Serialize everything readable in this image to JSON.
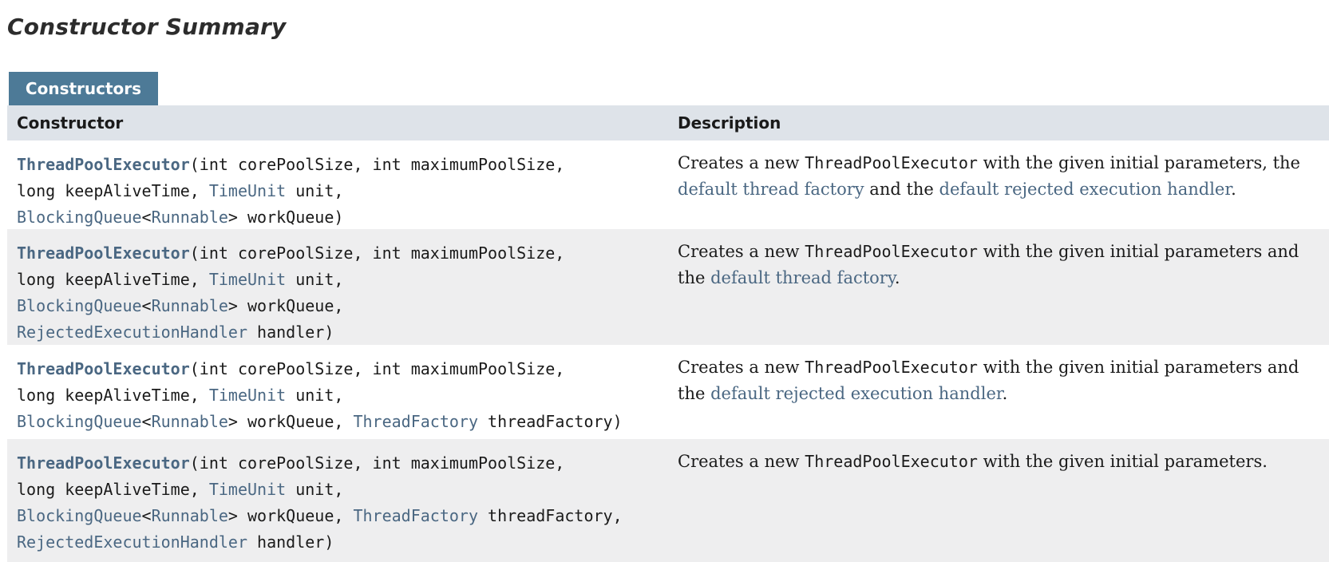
{
  "section_title": "Constructor Summary",
  "caption": "Constructors",
  "table": {
    "headers": {
      "constructor": "Constructor",
      "description": "Description"
    },
    "rows": [
      {
        "name": "ThreadPoolExecutor",
        "sig": {
          "p1": "(int corePoolSize, int maximumPoolSize,",
          "p2": "long keepAliveTime, ",
          "t_timeunit": "TimeUnit",
          "p3": " unit,",
          "t_bq": "BlockingQueue",
          "lt": "<",
          "t_runnable": "Runnable",
          "p4": "> workQueue)"
        },
        "desc": {
          "d1": "Creates a new ",
          "code": "ThreadPoolExecutor",
          "d2": " with the given initial parameters, the ",
          "link1": "default thread factory",
          "d3": " and the ",
          "link2": "default rejected execution handler",
          "d4": "."
        }
      },
      {
        "name": "ThreadPoolExecutor",
        "sig": {
          "p1": "(int corePoolSize, int maximumPoolSize,",
          "p2": "long keepAliveTime, ",
          "t_timeunit": "TimeUnit",
          "p3": " unit,",
          "t_bq": "BlockingQueue",
          "lt": "<",
          "t_runnable": "Runnable",
          "p4": "> workQueue,",
          "t_reh": "RejectedExecutionHandler",
          "p5": " handler)"
        },
        "desc": {
          "d1": "Creates a new ",
          "code": "ThreadPoolExecutor",
          "d2": " with the given initial parameters and the ",
          "link1": "default thread factory",
          "d3": "."
        }
      },
      {
        "name": "ThreadPoolExecutor",
        "sig": {
          "p1": "(int corePoolSize, int maximumPoolSize,",
          "p2": "long keepAliveTime, ",
          "t_timeunit": "TimeUnit",
          "p3": " unit,",
          "t_bq": "BlockingQueue",
          "lt": "<",
          "t_runnable": "Runnable",
          "p4": "> workQueue, ",
          "t_tf": "ThreadFactory",
          "p5": " threadFactory)"
        },
        "desc": {
          "d1": "Creates a new ",
          "code": "ThreadPoolExecutor",
          "d2": " with the given initial parameters and the ",
          "link1": "default rejected execution handler",
          "d3": "."
        }
      },
      {
        "name": "ThreadPoolExecutor",
        "sig": {
          "p1": "(int corePoolSize, int maximumPoolSize,",
          "p2": "long keepAliveTime, ",
          "t_timeunit": "TimeUnit",
          "p3": " unit,",
          "t_bq": "BlockingQueue",
          "lt": "<",
          "t_runnable": "Runnable",
          "p4": "> workQueue, ",
          "t_tf": "ThreadFactory",
          "p5": " threadFactory,",
          "t_reh": "RejectedExecutionHandler",
          "p6": " handler)"
        },
        "desc": {
          "d1": "Creates a new ",
          "code": "ThreadPoolExecutor",
          "d2": " with the given initial parameters."
        }
      }
    ]
  },
  "colors": {
    "caption_bg": "#4d7a97",
    "header_bg": "#dee3e9",
    "alt_row_bg": "#eeeeef",
    "link": "#4a6782"
  }
}
